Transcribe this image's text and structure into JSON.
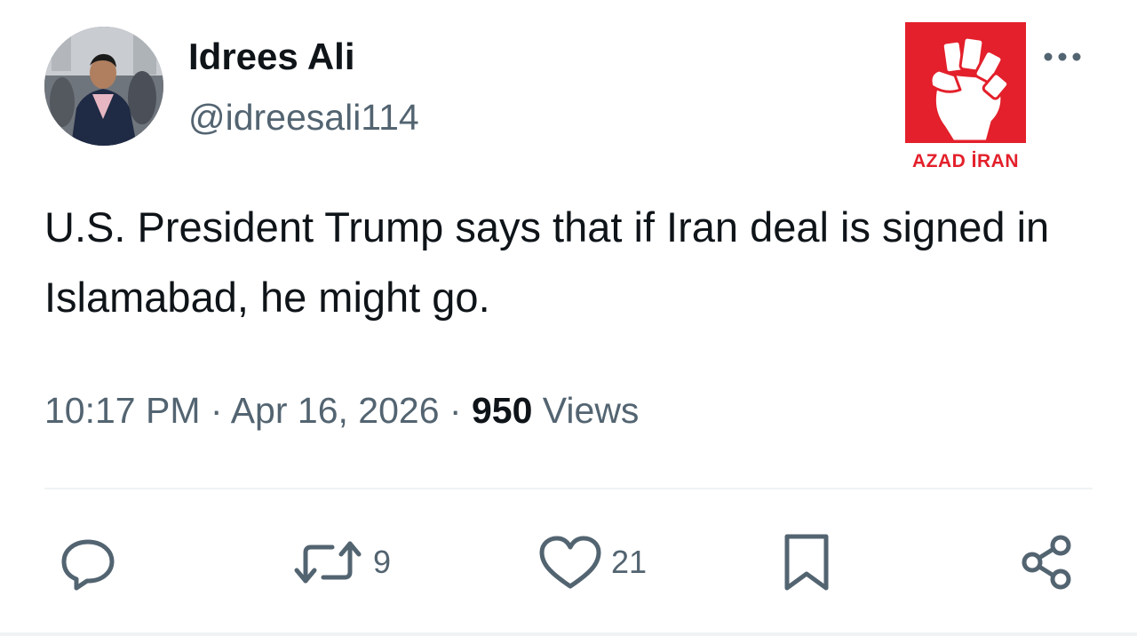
{
  "author": {
    "display_name": "Idrees Ali",
    "handle": "@idreesali114"
  },
  "watermark": {
    "text": "AZAD İRAN",
    "color": "#e3202b"
  },
  "tweet": {
    "text": "U.S. President Trump says that if Iran deal is signed in Islamabad, he might go.",
    "time": "10:17 PM",
    "separator": "·",
    "date": "Apr 16, 2026",
    "views_count": "950",
    "views_label": "Views"
  },
  "actions": {
    "reply_icon": "reply-icon",
    "retweet_icon": "retweet-icon",
    "retweet_count": "9",
    "like_icon": "heart-icon",
    "like_count": "21",
    "bookmark_icon": "bookmark-icon",
    "share_icon": "share-icon"
  },
  "colors": {
    "text": "#0f1419",
    "secondary_text": "#536471",
    "divider": "#eff3f4"
  }
}
